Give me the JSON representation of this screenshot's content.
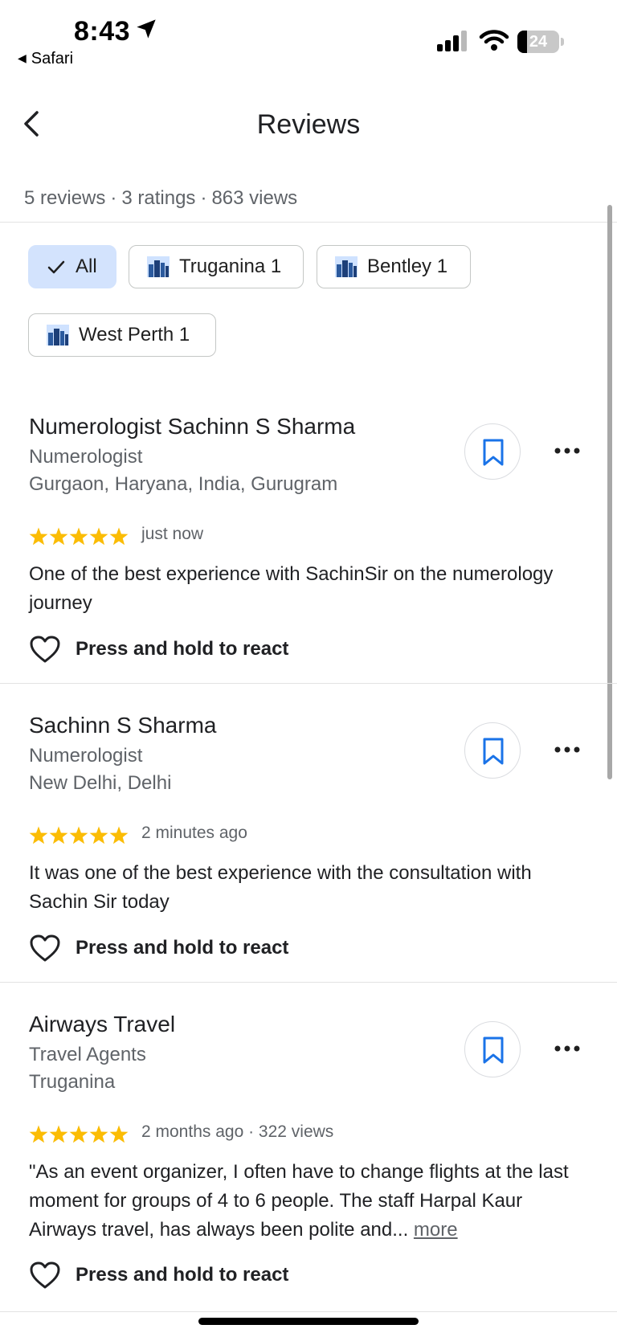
{
  "status_bar": {
    "time": "8:43",
    "back_app": "Safari",
    "battery_level": "24",
    "battery_fraction": 0.24
  },
  "header": {
    "title": "Reviews",
    "stats": [
      "5 reviews",
      "3 ratings",
      "863 views"
    ],
    "separator": "·"
  },
  "filters": [
    {
      "label": "All",
      "selected": true
    },
    {
      "label": "Truganina 1",
      "selected": false
    },
    {
      "label": "Bentley 1",
      "selected": false
    },
    {
      "label": "West Perth 1",
      "selected": false
    }
  ],
  "reviews": [
    {
      "title": "Numerologist Sachinn S Sharma",
      "category": "Numerologist",
      "location": "Gurgaon, Haryana, India, Gurugram",
      "rating": 5,
      "time": "just now",
      "text": "One of the best experience with SachinSir on the numerology journey",
      "react_label": "Press and hold to react"
    },
    {
      "title": "Sachinn S Sharma",
      "category": "Numerologist",
      "location": "New Delhi, Delhi",
      "rating": 5,
      "time": "2 minutes ago",
      "text": "It was one of the best experience with the consultation with Sachin Sir today",
      "react_label": "Press and hold to react"
    },
    {
      "title": "Airways Travel",
      "category": "Travel Agents",
      "location": "Truganina",
      "rating": 5,
      "time": "2 months ago · 322 views",
      "text": "\"As an event organizer, I often have to change flights at the last moment for groups of 4 to 6 people. The staff Harpal Kaur  Airways travel, has always been polite and...",
      "more_label": "more",
      "react_label": "Press and hold to react"
    }
  ],
  "colors": {
    "star": "#fbbc04",
    "accent_blue": "#1a73e8",
    "chip_selected_bg": "#d3e3fd",
    "secondary_text": "#5f6368"
  },
  "icons": {
    "back": "chevron-left-icon",
    "check": "check-icon",
    "city": "city-icon",
    "bookmark": "bookmark-icon",
    "more": "more-horizontal-icon",
    "heart": "heart-outline-icon"
  }
}
